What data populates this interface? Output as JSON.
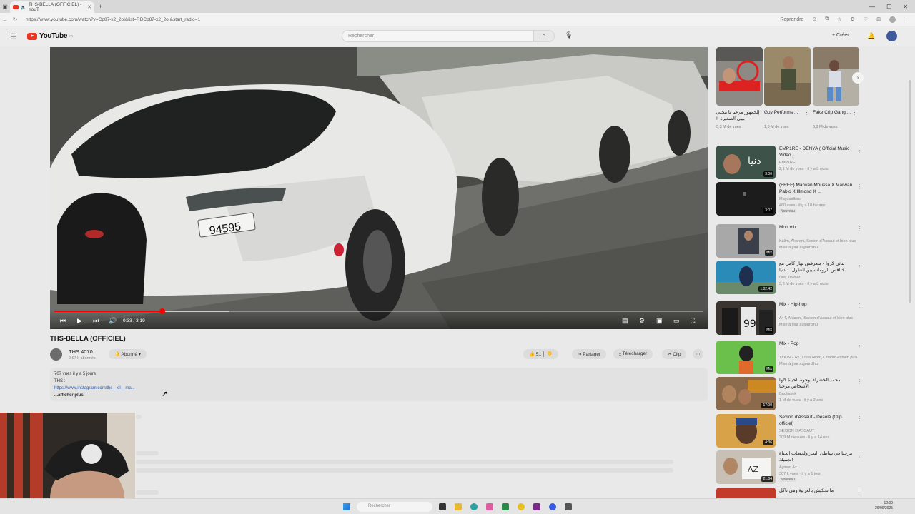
{
  "browser": {
    "tab_title": "THS-BELLA (OFFICIEL) - YouT",
    "url": "https://www.youtube.com/watch?v=Cp87-x2_2oI&list=RDCp87-x2_2oI&start_radio=1",
    "resume_label": "Reprendre"
  },
  "header": {
    "logo_text": "YouTube",
    "logo_region": "FR",
    "search_placeholder": "Rechercher",
    "create_label": "Créer"
  },
  "player": {
    "time_display": "0:33 / 3:19",
    "progress_fraction": 0.166,
    "buffered_fraction": 0.27
  },
  "video": {
    "title": "THS-BELLA (OFFICIEL)",
    "channel": "THS 4070",
    "subscribers": "2,97 k abonnés",
    "subscribe_label": "Abonné",
    "likes": "51",
    "share_label": "Partager",
    "download_label": "Télécharger",
    "clip_label": "Clip"
  },
  "description": {
    "meta": "707 vues  il y a 5 jours",
    "line1": "THS :",
    "link": "https://www.instagram.com/ths__el__ma...",
    "more_label": "...afficher plus"
  },
  "shelf": [
    {
      "title": "الجمهور مرحبا يا محبي بيبي الصغيرة !!",
      "views": "5,3 M de vues"
    },
    {
      "title": "Guy Performs ...",
      "views": "1,5 M de vues"
    },
    {
      "title": "Fake Crip Gang ...",
      "views": "6,9 M de vues"
    }
  ],
  "recommendations": [
    {
      "title": "EMP1RE - DENYA ( Official Music Video )",
      "channel": "EMP1RE",
      "meta": "2,1 M de vues · il y a 8 mois",
      "duration": "3:00",
      "badge": ""
    },
    {
      "title": "(FREE) Marwan Moussa X Marwan Pablo X Illmond X ...",
      "channel": "Maydaaikmo",
      "meta": "480 vues · il y a 10 heures",
      "duration": "3:07",
      "badge": "Nouveau"
    },
    {
      "title": "Mon mix",
      "channel": "Kalim, Akaroni, Sexion d'Assaut et bien plus",
      "meta": "Mise à jour aujourd'hui",
      "duration": "Mix",
      "badge": ""
    },
    {
      "title": "ثنائي كروا - متعرفش نهار كامل مع خنافس الرومانسيين العقول ... دنيا",
      "channel": "Draj Jawher",
      "meta": "3,3 M de vues · il y a 8 mois",
      "duration": "1:02:42",
      "badge": ""
    },
    {
      "title": "Mix - Hip-hop",
      "channel": "A44, Akaroni, Sexion d'Assaut et bien plus",
      "meta": "Mise à jour aujourd'hui",
      "duration": "Mix",
      "badge": ""
    },
    {
      "title": "Mix - Pop",
      "channel": "YOUNG RZ, Lorin alken, Dhafiro et bien plus",
      "meta": "Mise à jour aujourd'hui",
      "duration": "Mix",
      "badge": ""
    },
    {
      "title": "محمد الخضراء بوجوه الحياة كلها الأشخاص مرحبا",
      "channel": "Bachakek",
      "meta": "1 M de vues · il y a 2 ans",
      "duration": "17:00",
      "badge": ""
    },
    {
      "title": "Sexion d'Assaut - Désolé (Clip officiel)",
      "channel": "SEXION D'ASSAUT",
      "meta": "309 M de vues · il y a 14 ans",
      "duration": "4:36",
      "badge": ""
    },
    {
      "title": "مرحبا في شاطئ البحر ولحظات الحياة الجميلة",
      "channel": "Ayman Az",
      "meta": "307 k vues · il y a 1 jour",
      "duration": "21:04",
      "badge": "Nouveau"
    },
    {
      "title": "ما تحكيش بالعربية وهي تاكل",
      "channel": "",
      "meta": "",
      "duration": "",
      "badge": ""
    }
  ],
  "taskbar": {
    "search_placeholder": "Rechercher",
    "time": "12:09",
    "date": "26/09/2025"
  }
}
